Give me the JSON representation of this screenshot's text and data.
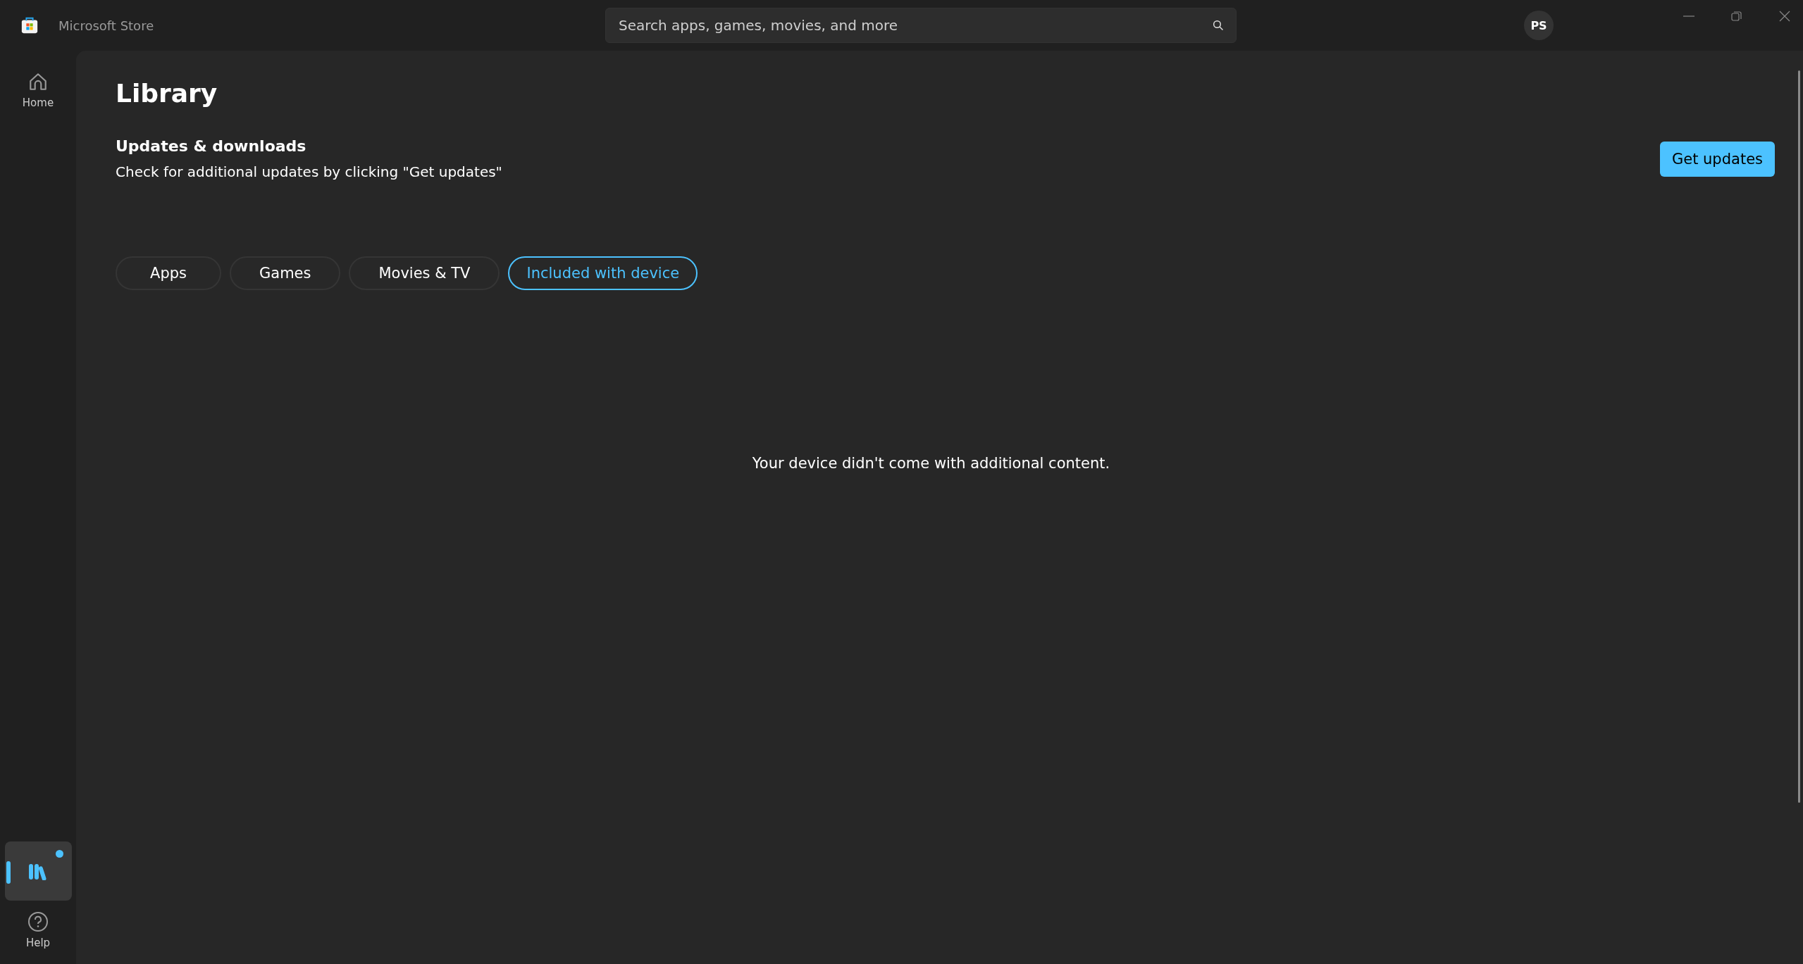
{
  "window": {
    "title": "Microsoft Store"
  },
  "search": {
    "placeholder": "Search apps, games, movies, and more"
  },
  "account": {
    "initials": "PS"
  },
  "sidebar": {
    "items": [
      {
        "kind": "home",
        "label": "Home",
        "selected": false,
        "notification": false
      },
      {
        "kind": "library",
        "selected": true,
        "notification": true
      },
      {
        "kind": "help",
        "label": "Help",
        "selected": false
      }
    ]
  },
  "page": {
    "title": "Library",
    "section_title": "Updates & downloads",
    "section_text": "Check for additional updates by clicking \"Get updates\"",
    "button": "Get updates"
  },
  "tabs": [
    {
      "label": "Apps",
      "selected": false
    },
    {
      "label": "Games",
      "selected": false
    },
    {
      "label": "Movies & TV",
      "selected": false
    },
    {
      "label": "Included with device",
      "selected": true
    }
  ],
  "empty_message": "Your device didn't come with additional content."
}
